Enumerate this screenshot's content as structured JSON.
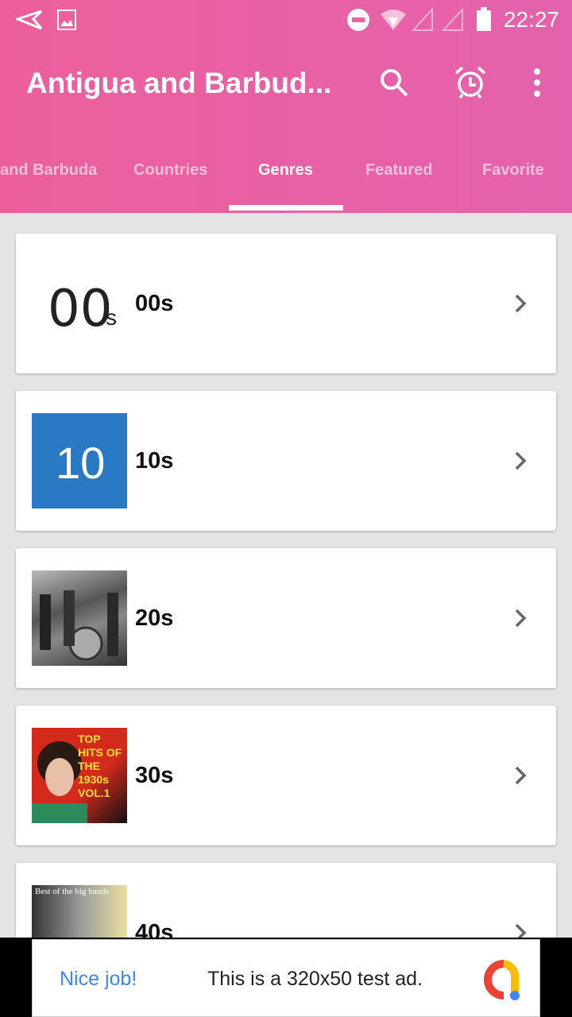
{
  "status_bar": {
    "time": "22:27",
    "icons": [
      "send-icon",
      "image-icon",
      "do-not-disturb-icon",
      "wifi-icon",
      "signal-icon",
      "signal-icon",
      "battery-icon"
    ]
  },
  "app_bar": {
    "title": "Antigua and Barbud...",
    "actions": [
      "search-icon",
      "alarm-icon",
      "more-vert-icon"
    ]
  },
  "tabs": [
    {
      "label": "and Barbuda"
    },
    {
      "label": "Countries"
    },
    {
      "label": "Genres",
      "active": true
    },
    {
      "label": "Featured"
    },
    {
      "label": "Favorite"
    }
  ],
  "genres": [
    {
      "label": "00s",
      "thumb_text": "00",
      "thumb_sub": "s"
    },
    {
      "label": "10s",
      "thumb_text": "10"
    },
    {
      "label": "20s"
    },
    {
      "label": "30s",
      "thumb_text": "TOP HITS OF THE 1930s VOL.1"
    },
    {
      "label": "40s",
      "thumb_text": "Best of the big bands"
    }
  ],
  "ad": {
    "headline": "Nice job!",
    "body": "This is a 320x50 test ad."
  },
  "colors": {
    "primary": "#ea5fa3",
    "ad_link": "#4285f4"
  }
}
